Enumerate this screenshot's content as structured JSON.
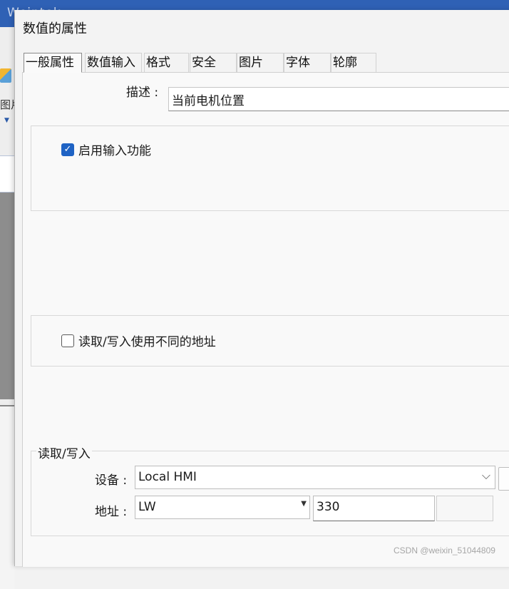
{
  "background_app": {
    "title": "Weintek...",
    "toolbar_label": "图片"
  },
  "dialog": {
    "title": "数值的属性",
    "tabs": [
      {
        "label": "一般属性",
        "active": true
      },
      {
        "label": "数值输入",
        "active": false
      },
      {
        "label": "格式",
        "active": false
      },
      {
        "label": "安全",
        "active": false
      },
      {
        "label": "图片",
        "active": false
      },
      {
        "label": "字体",
        "active": false
      },
      {
        "label": "轮廓",
        "active": false
      }
    ],
    "description": {
      "label": "描述 :",
      "value": "当前电机位置"
    },
    "enable_input": {
      "label": "启用输入功能",
      "checked": true
    },
    "separate_rw_address": {
      "label": "读取/写入使用不同的地址",
      "checked": false
    },
    "read_write": {
      "legend": "读取/写入",
      "device_label": "设备 :",
      "device_value": "Local HMI",
      "address_label": "地址 :",
      "address_type": "LW",
      "address_value": "330"
    }
  },
  "watermark": "CSDN @weixin_51044809",
  "colors": {
    "accent": "#1f63c4",
    "titlebar": "#2f61b5"
  }
}
